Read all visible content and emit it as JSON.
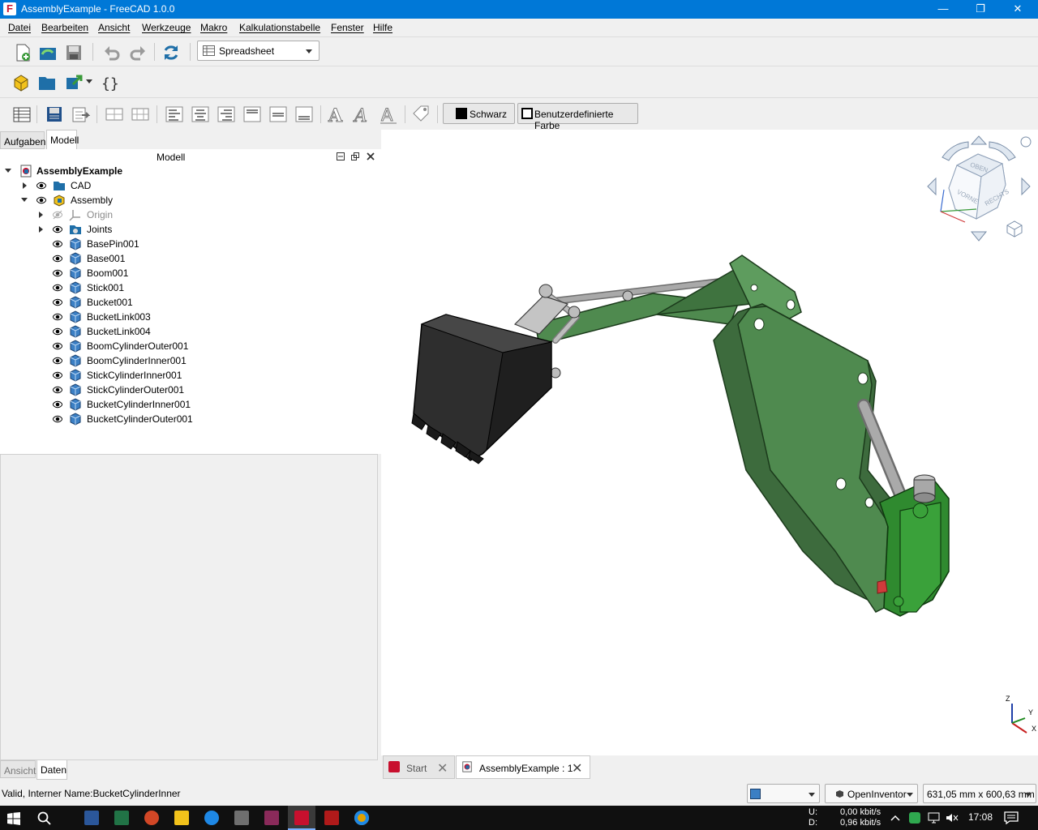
{
  "window": {
    "title": "AssemblyExample - FreeCAD 1.0.0",
    "minimize": "—",
    "maximize": "❐",
    "close": "✕"
  },
  "menu": [
    "Datei",
    "Bearbeiten",
    "Ansicht",
    "Werkzeuge",
    "Makro",
    "Kalkulationstabelle",
    "Fenster",
    "Hilfe"
  ],
  "workbench": {
    "selected": "Spreadsheet"
  },
  "format": {
    "black_label": "Schwarz",
    "custom_color_label": "Benutzerdefinierte Farbe"
  },
  "left_tabs": {
    "tasks": "Aufgaben",
    "model": "Modell"
  },
  "panel": {
    "title": "Modell"
  },
  "tree": {
    "root": "AssemblyExample",
    "cad": "CAD",
    "assembly": "Assembly",
    "origin": "Origin",
    "joints": "Joints",
    "parts": [
      "BasePin001",
      "Base001",
      "Boom001",
      "Stick001",
      "Bucket001",
      "BucketLink003",
      "BucketLink004",
      "BoomCylinderOuter001",
      "BoomCylinderInner001",
      "StickCylinderInner001",
      "StickCylinderOuter001",
      "BucketCylinderInner001",
      "BucketCylinderOuter001"
    ]
  },
  "bottom_tabs": {
    "view": "Ansicht",
    "data": "Daten"
  },
  "navcube": {
    "top": "OBEN",
    "front": "VORNE",
    "right": "RECHTS"
  },
  "axes": {
    "z": "Z",
    "y": "Y",
    "x": "X"
  },
  "doc_tabs": {
    "start": "Start",
    "assembly": "AssemblyExample : 1"
  },
  "status": {
    "message": "Valid, Interner Name:BucketCylinderInner",
    "nav_style": "OpenInventor",
    "dimensions": "631,05 mm x 600,63 mm"
  },
  "taskbar": {
    "up_label": "U:",
    "down_label": "D:",
    "up_rate": "0,00 kbit/s",
    "down_rate": "0,96 kbit/s",
    "time": "17:08"
  },
  "colors": {
    "titlebar": "#0078d7",
    "model_green": "#4f8a4f",
    "bucket": "#2f2f2f",
    "pin": "#b0b0b0"
  }
}
